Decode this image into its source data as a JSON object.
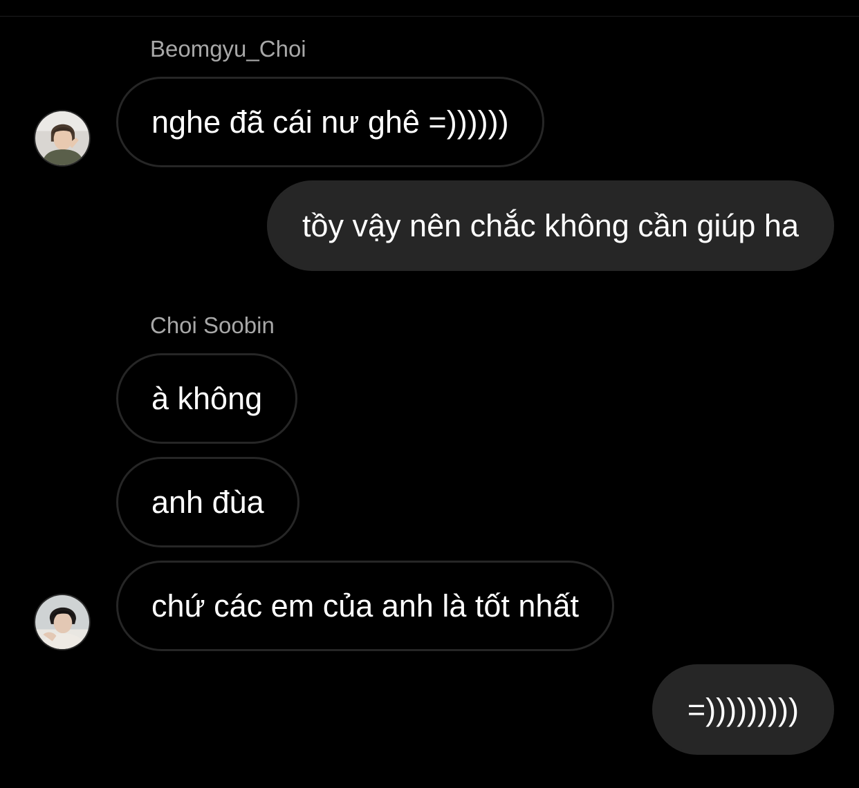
{
  "conversation": {
    "groups": [
      {
        "sender": "Beomgyu_Choi",
        "avatar_icon": "person-avatar-icon",
        "messages": [
          "nghe đã cái nư ghê =))))))"
        ]
      },
      {
        "sender": "me",
        "messages": [
          "tồy vậy nên chắc không cần giúp ha"
        ]
      },
      {
        "sender": "Choi Soobin",
        "avatar_icon": "person-avatar-icon",
        "messages": [
          "à không",
          "anh đùa",
          "chứ các em của anh là tốt nhất"
        ]
      },
      {
        "sender": "me",
        "messages": [
          "=)))))))))"
        ]
      }
    ]
  },
  "colors": {
    "background": "#000000",
    "sent_bubble": "#262626",
    "received_border": "#262626",
    "sender_name": "#a8a8a8",
    "text": "#ffffff"
  }
}
